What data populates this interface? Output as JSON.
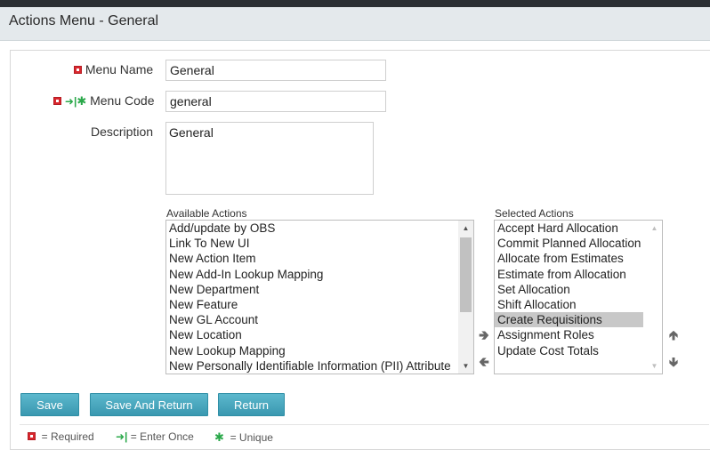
{
  "window": {
    "title": "Actions Menu - General"
  },
  "form": {
    "menu_name_label": "Menu Name",
    "menu_name_value": "General",
    "menu_code_label": "Menu Code",
    "menu_code_value": "general",
    "description_label": "Description",
    "description_value": "General"
  },
  "available_actions": {
    "caption": "Available Actions",
    "items": [
      "Add/update by OBS",
      "Link To New UI",
      "New Action Item",
      "New Add-In Lookup Mapping",
      "New Department",
      "New Feature",
      "New GL Account",
      "New Location",
      "New Lookup Mapping",
      "New Personally Identifiable Information (PII) Attribute"
    ]
  },
  "selected_actions": {
    "caption": "Selected Actions",
    "selected_item": "Create Requisitions",
    "items": [
      "Accept Hard Allocation",
      "Commit Planned Allocation",
      "Allocate from Estimates",
      "Estimate from Allocation",
      "Set Allocation",
      "Shift Allocation",
      "Create Requisitions",
      "Assignment Roles",
      "Update Cost Totals"
    ]
  },
  "buttons": {
    "save": "Save",
    "save_and_return": "Save And Return",
    "return": "Return"
  },
  "legend": {
    "required": "= Required",
    "enter_once": "= Enter Once",
    "unique": "= Unique"
  },
  "colors": {
    "required_icon": "#d9272e",
    "enter_once_icon": "#2aa84a",
    "unique_icon": "#2aa84a",
    "button": "#4aa8c0"
  }
}
